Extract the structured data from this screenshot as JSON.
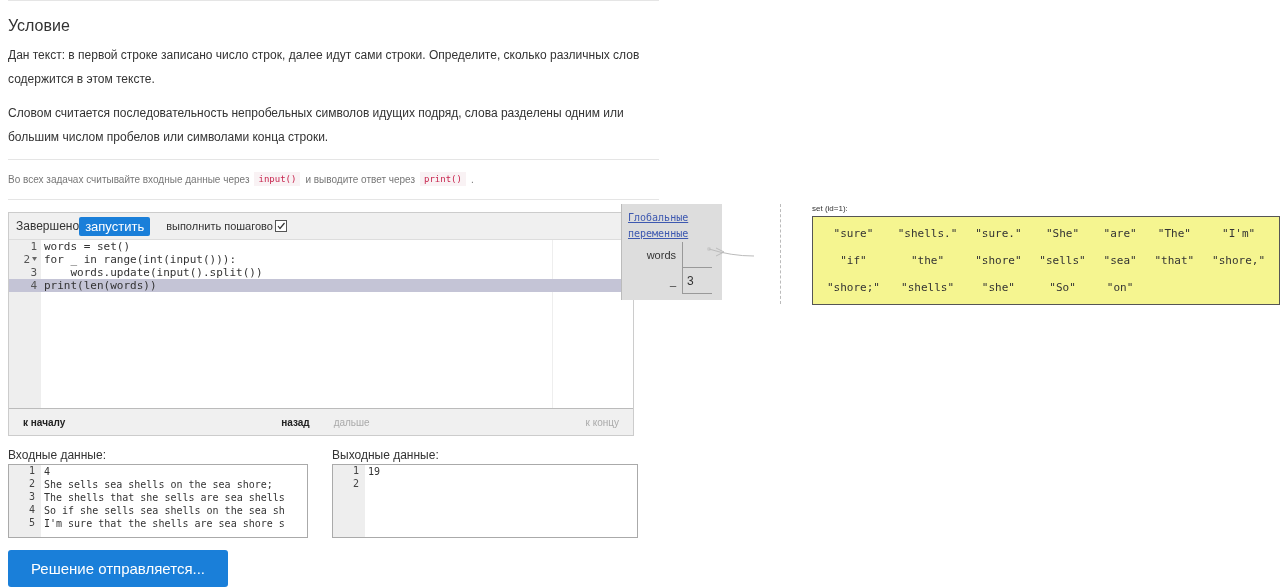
{
  "problem": {
    "heading": "Условие",
    "paragraphs": [
      "Дан текст: в первой строке записано число строк, далее идут сами строки. Определите, сколько различных слов содержится в этом тексте.",
      "Словом считается последовательность непробельных символов идущих подряд, слова разделены одним или большим числом пробелов или символами конца строки."
    ],
    "note": [
      {
        "kind": "text",
        "text": "Во всех задачах считывайте входные данные через"
      },
      {
        "kind": "code",
        "text": "input()"
      },
      {
        "kind": "text",
        "text": "и выводите ответ через"
      },
      {
        "kind": "code",
        "text": "print()"
      },
      {
        "kind": "text",
        "text": "."
      }
    ]
  },
  "editor": {
    "status": "Завершено",
    "run_button": "запустить",
    "step_label": "выполнить пошагово",
    "step_checked": true,
    "lines": [
      {
        "number": "1",
        "text": "words = set()",
        "current": false,
        "foldable": false
      },
      {
        "number": "2",
        "text": "for _ in range(int(input())):",
        "current": false,
        "foldable": true
      },
      {
        "number": "3",
        "text": "    words.update(input().split())",
        "current": false,
        "foldable": false
      },
      {
        "number": "4",
        "text": "print(len(words))",
        "current": true,
        "foldable": false
      }
    ],
    "nav": [
      {
        "label": "к началу",
        "disabled": false
      },
      {
        "label": "назад",
        "disabled": false
      },
      {
        "label": "дальше",
        "disabled": true
      },
      {
        "label": "к концу",
        "disabled": true
      }
    ]
  },
  "input": {
    "label": "Входные данные:",
    "lines": [
      {
        "number": "1",
        "text": "4"
      },
      {
        "number": "2",
        "text": "She sells sea shells on the sea shore;"
      },
      {
        "number": "3",
        "text": "The shells that she sells are sea shells"
      },
      {
        "number": "4",
        "text": "So if she sells sea shells on the sea sh"
      },
      {
        "number": "5",
        "text": "I'm sure that the shells are sea shore s"
      }
    ]
  },
  "output": {
    "label": "Выходные данные:",
    "lines": [
      {
        "number": "1",
        "text": "19"
      },
      {
        "number": "2"
      }
    ]
  },
  "submit_button": "Решение отправляется...",
  "frames": {
    "title": "Глобальные переменные",
    "variables": [
      {
        "name": "words"
      },
      {
        "name": "_",
        "value": "3"
      }
    ]
  },
  "set_object": {
    "title": "set (id=1):",
    "items": [
      "\"sure\"",
      "\"shells.\"",
      "\"sure.\"",
      "\"She\"",
      "\"are\"",
      "\"The\"",
      "\"I'm\"",
      "\"if\"",
      "\"the\"",
      "\"shore\"",
      "\"sells\"",
      "\"sea\"",
      "\"that\"",
      "\"shore,\"",
      "\"shore;\"",
      "\"shells\"",
      "\"she\"",
      "\"So\"",
      "\"on\""
    ]
  }
}
